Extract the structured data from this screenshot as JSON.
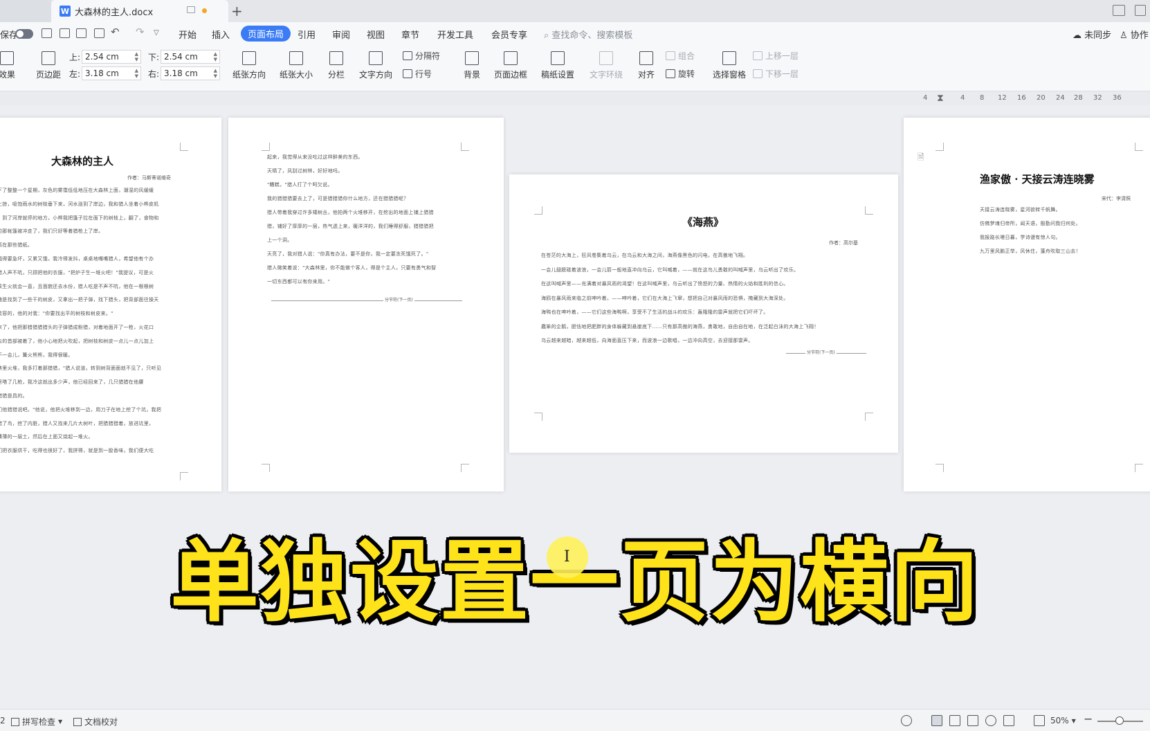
{
  "tab": {
    "title": "大森林的主人.docx",
    "icon_letter": "W"
  },
  "menu": {
    "save_label": "保存",
    "items": [
      "开始",
      "插入",
      "页面布局",
      "引用",
      "审阅",
      "视图",
      "章节",
      "开发工具",
      "会员专享"
    ],
    "active": "页面布局",
    "search_placeholder": "查找命令、搜索模板",
    "sync_label": "未同步",
    "collab_label": "协作"
  },
  "ribbon": {
    "effect_label": "效果",
    "margins_label": "页边距",
    "top_label": "上:",
    "top_value": "2.54 cm",
    "bottom_label": "下:",
    "bottom_value": "2.54 cm",
    "left_label": "左:",
    "left_value": "3.18 cm",
    "right_label": "右:",
    "right_value": "3.18 cm",
    "orientation_label": "纸张方向",
    "size_label": "纸张大小",
    "columns_label": "分栏",
    "text_direction_label": "文字方向",
    "separator_label": "分隔符",
    "line_number_label": "行号",
    "background_label": "背景",
    "page_border_label": "页面边框",
    "manuscript_label": "稿纸设置",
    "wrap_label": "文字环绕",
    "align_label": "对齐",
    "group_label": "组合",
    "rotate_label": "旋转",
    "select_pane_label": "选择窗格",
    "up_layer_label": "上移一层",
    "down_layer_label": "下移一层"
  },
  "ruler": {
    "ticks": [
      "4",
      "4",
      "8",
      "12",
      "16",
      "20",
      "24",
      "28",
      "32",
      "36"
    ]
  },
  "pages": {
    "p1": {
      "title": "大森林的主人",
      "author": "作者：马斯蒂诺维奇",
      "lines": [
        "下了整整一个星期，灰色的雾霭低低地压在大森林上面，潮湿的风缓缓",
        "上掠，吸饱雨水的树枝垂下来，河水涨到了岸边，我和猎人坐着小桦皮机",
        "，到了河岸就停的地方，小桦我把篷子拉在面下的树枝上，翻了，食物和",
        "的那帐篷被冲走了，我们只好等着猎枪上了岸。",
        "高在那些猎纸。",
        "饿得要急坏，又累又饿，我冷得发抖，桌桌地嘴嘴猎人，希望他有个办",
        "猎人声不吭，只顾把他的衣服，\"把炉子生一堆火吧！\"我提议，可是火",
        "果生火就会一直，且面貌还去水份，猎人吃是不声不吭，他在一根根树",
        "随是找到了一些干的树皮，又拿出一把子弹，找下猎头，把背部面往操天",
        "笑容的，他的对我：\"你要找出平的树枝和树皮来。\"",
        "来了，他把那猎猎猎猎头的子弹猎成粉猎，对着地面开了一枪，火花口",
        "去的首部被着了，他小心地把火吹起，把树枝和树皮一点儿一点儿加上",
        "不一会儿，篝火熊熊，我得很暖。",
        "林里火堆，我多打着那猎猎，\"猎人说道，转到树背面面就不见了，只听见",
        "里嗒了几枪，我冷这就出多少声，他已经回来了，几只猎猎在他腰",
        "猎猎是具的。",
        "们他猎猎说吧。\"他说，他把火堆移到一边，用刀子在地上挖了个坑，我把",
        "猎了鸟，挖了内脏，猎人又找来几片大树叶，把猎猎猎着，放进坑里，",
        "薄薄的一层土，然后在上面又烧起一堆火。",
        "们把衣服烘干，吃得也很好了，我拼得，就是到一股香味，我们便大吃"
      ]
    },
    "p2": {
      "lines": [
        "起来，我觉得从来没吃过这样鲜美的东西。",
        "天晴了，风刮过树林，好好地吗。",
        "\"糟糕，\"猎人打了个呵欠说。",
        "我的猎猎猎要去上了，可是猎猎猎你什么地方，还在猎猎猎呢？",
        "猎人带着我穿过许多矮树丛，他拍两个火堆移开，在挖出的地面上铺上猎猎",
        "猎，铺好了厚厚的一层，热气透上来，暖洋洋的，我们睡得舒服，猎猎猎把",
        "上一个洞。",
        "天亮了，我对猎人说：\"你真有办法，要不是你，我一定要冻死饿死了。\"",
        "猎人微笑着说：\"大森林里，你不能做个客人，得是个主人，只要有勇气和智",
        "一切东西都可以有你来用。\""
      ],
      "break_text": "分节符(下一页)"
    },
    "p3": {
      "title": "《海燕》",
      "author": "作者：高尔基",
      "lines": [
        "在苍茫的大海上，狂风卷集着乌云，在乌云和大海之间，海燕像黑色的闪电，在高傲地飞翔。",
        "一会儿翅膀碰着波浪，一会儿箭一般地直冲向乌云，它叫喊着，——就在这鸟儿勇敢的叫喊声里，乌云听出了欢乐。",
        "在这叫喊声里——充满着对暴风雨的渴望！在这叫喊声里，乌云听出了愤怒的力量、热情的火焰和胜利的信心。",
        "海鸥在暴风雨来临之前呻吟着，——呻吟着，它们在大海上飞窜，想把自己对暴风雨的恐惧，掩藏到大海深处。",
        "海鸭也在呻吟着，——它们这些海鸭啊，享受不了生活的战斗的欢乐：轰隆隆的雷声就把它们吓坏了。",
        "蠢笨的企鹅，胆怯地把肥胖的身体躲藏到悬崖底下……只有那高傲的海燕，勇敢地，自由自在地，在泛起白沫的大海上飞翔！",
        "乌云越来越暗，越来越低，向海面直压下来，而波浪一边歌唱，一边冲向高空，去迎接那雷声。"
      ],
      "break_text": "分节符(下一页)"
    },
    "p4": {
      "title": "渔家傲 · 天接云涛连晓雾",
      "author": "宋代：李清照",
      "lines": [
        "天接云涛连晓雾，星河欲转千帆舞。",
        "仿佛梦魂归帝所，闻天语，殷勤问我归何处。",
        "我报路长嗟日暮，学诗谩有惊人句。",
        "九万里风鹏正举，风休住，蓬舟吹取三山去！"
      ]
    }
  },
  "caption": "单独设置一页为横向",
  "status": {
    "page_num": "2",
    "spell_check": "拼写检查",
    "doc_proof": "文档校对",
    "zoom": "50%"
  }
}
